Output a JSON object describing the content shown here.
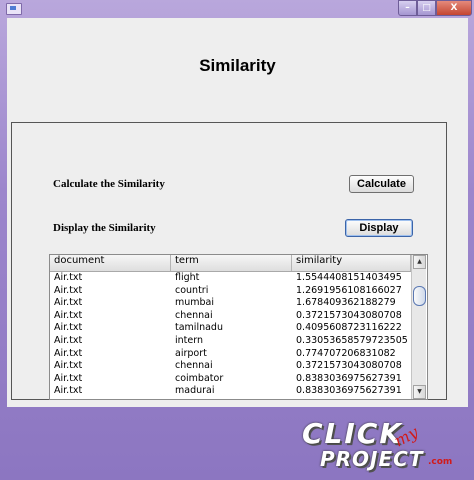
{
  "window": {
    "minimize_glyph": "–",
    "maximize_glyph": "□",
    "close_glyph": "X"
  },
  "title": "Similarity",
  "calculate": {
    "label": "Calculate the Similarity",
    "button": "Calculate"
  },
  "display": {
    "label": "Display the Similarity",
    "button": "Display"
  },
  "table": {
    "headers": [
      "document",
      "term",
      "similarity"
    ],
    "rows": [
      [
        "Air.txt",
        "flight",
        "1.5544408151403495"
      ],
      [
        "Air.txt",
        "countri",
        "1.2691956108166027"
      ],
      [
        "Air.txt",
        "mumbai",
        "1.678409362188279"
      ],
      [
        "Air.txt",
        "chennai",
        "0.3721573043080708"
      ],
      [
        "Air.txt",
        "tamilnadu",
        "0.4095608723116222"
      ],
      [
        "Air.txt",
        "intern",
        "0.33053658579723505"
      ],
      [
        "Air.txt",
        "airport",
        "0.774707206831082"
      ],
      [
        "Air.txt",
        "chennai",
        "0.3721573043080708"
      ],
      [
        "Air.txt",
        "coimbator",
        "0.8383036975627391"
      ],
      [
        "Air.txt",
        "madurai",
        "0.8383036975627391"
      ]
    ],
    "scroll_up_glyph": "▲",
    "scroll_down_glyph": "▼"
  },
  "logo": {
    "click": "CLICK",
    "my": "my",
    "project": "PROJECT",
    "dotcom": ".com"
  },
  "icons": [
    "app-icon",
    "minimize-icon",
    "maximize-icon",
    "close-icon"
  ],
  "colors": {
    "frame": "#9c86cc",
    "close_button": "#c44631",
    "panel_bg": "#eeeeee",
    "logo_accent": "#d11a1a"
  }
}
